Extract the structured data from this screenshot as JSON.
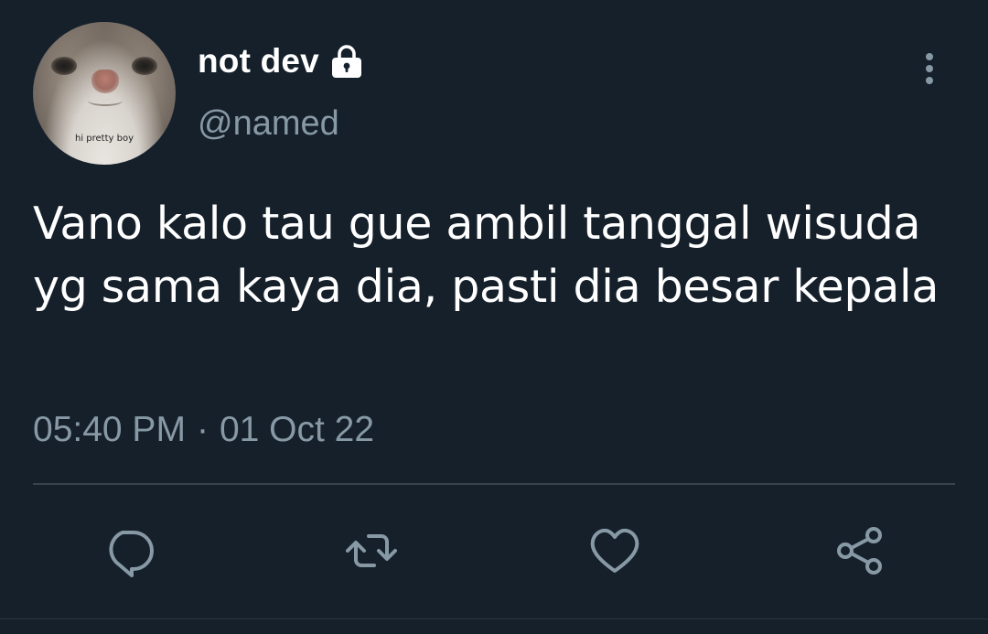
{
  "user": {
    "display_name": "not dev",
    "handle": "@named",
    "protected_icon": "lock-icon",
    "avatar_caption": "hi pretty boy"
  },
  "tweet": {
    "text": "Vano kalo tau gue ambil tanggal wisuda yg sama kaya dia, pasti dia besar kepala",
    "time": "05:40 PM",
    "separator": "·",
    "date": "01 Oct 22"
  },
  "actions": [
    {
      "name": "reply",
      "icon": "reply-icon"
    },
    {
      "name": "retweet",
      "icon": "retweet-icon"
    },
    {
      "name": "like",
      "icon": "heart-icon"
    },
    {
      "name": "share",
      "icon": "share-icon"
    }
  ],
  "menu_icon": "more-vertical-icon",
  "colors": {
    "background": "#15202b",
    "primary_text": "#ffffff",
    "secondary_text": "#8899a6",
    "divider": "#38444d"
  }
}
